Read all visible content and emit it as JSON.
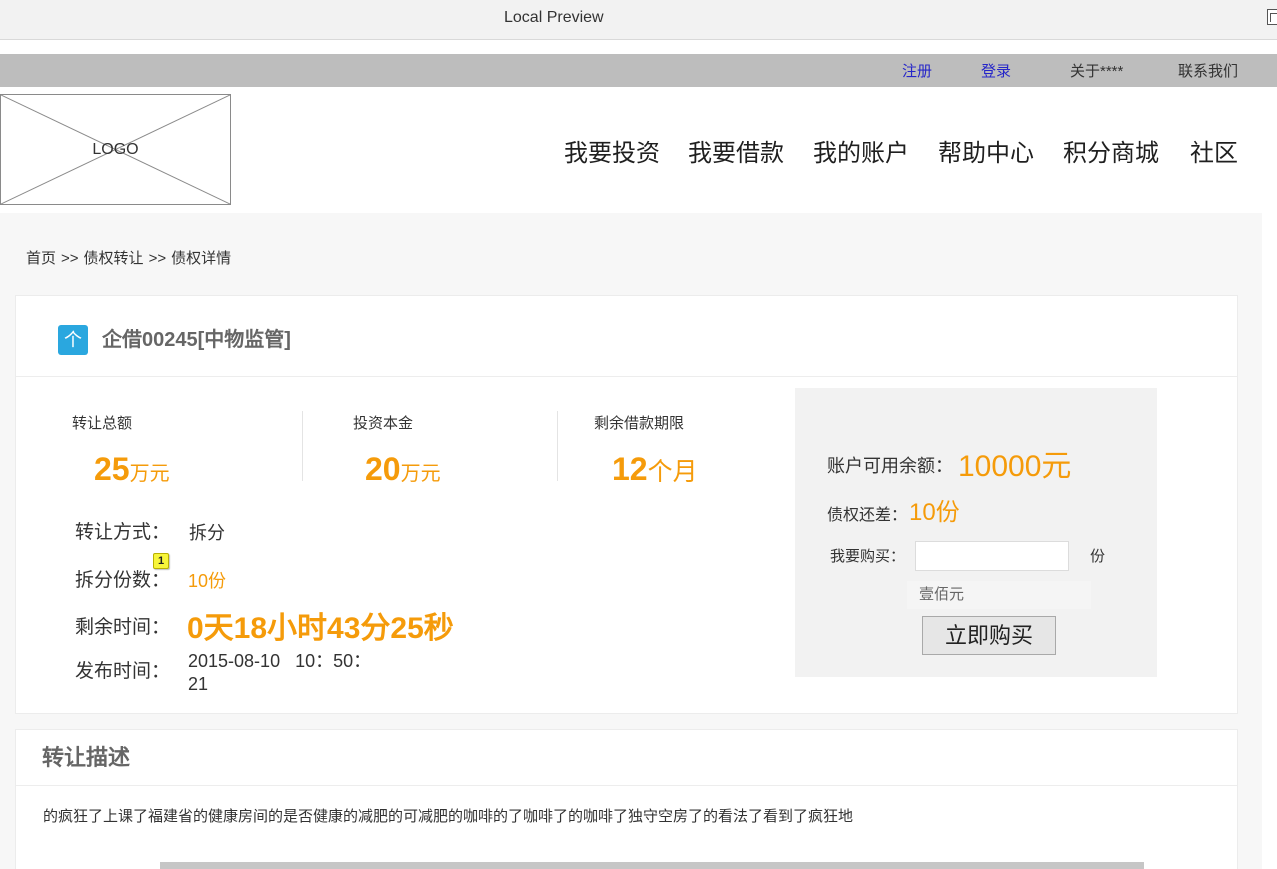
{
  "window": {
    "title": "Local Preview"
  },
  "colors": {
    "accent": "#f59b0a",
    "link": "#2626c9",
    "brand": "#2aa7df",
    "topbar": "#bdbdbd",
    "button": "#e6e6e6"
  },
  "icons": {
    "window": "window-icon",
    "logo": "logo-placeholder",
    "loan": "loan-badge-icon"
  },
  "topbar": {
    "links": [
      {
        "label": "注册"
      },
      {
        "label": "登录"
      },
      {
        "label": "关于****"
      },
      {
        "label": "联系我们"
      }
    ]
  },
  "header": {
    "logo_text": "LOGO",
    "nav": [
      {
        "label": "我要投资"
      },
      {
        "label": "我要借款"
      },
      {
        "label": "我的账户"
      },
      {
        "label": "帮助中心"
      },
      {
        "label": "积分商城"
      },
      {
        "label": "社区"
      }
    ]
  },
  "breadcrumb": {
    "items": [
      "首页",
      "债权转让",
      "债权详情"
    ],
    "separator": ">>"
  },
  "loan": {
    "icon_text": "个",
    "title": "企借00245[中物监管]",
    "stats": [
      {
        "label": "转让总额",
        "value": "25",
        "unit": "万元"
      },
      {
        "label": "投资本金",
        "value": "20",
        "unit": "万元"
      },
      {
        "label": "剩余借款期限",
        "value": "12",
        "unit": "个月"
      }
    ],
    "details": [
      {
        "label": "转让方式：",
        "value": "拆分"
      },
      {
        "label": "拆分份数：",
        "value": "10份"
      },
      {
        "label": "剩余时间：",
        "value": "0天18小时43分25秒"
      },
      {
        "label": "发布时间：",
        "value": "2015-08-10   10：50：21"
      }
    ],
    "annotation_marker": "1"
  },
  "purchase": {
    "balance_label": "账户可用余额：",
    "balance_value": "10000元",
    "remaining_label": "债权还差：",
    "remaining_value": "10份",
    "buy_label": "我要购买：",
    "buy_unit": "份",
    "amount_in_words": "壹佰元",
    "button_label": "立即购买"
  },
  "description": {
    "title": "转让描述",
    "text": "的疯狂了上课了福建省的健康房间的是否健康的减肥的可减肥的咖啡的了咖啡了的咖啡了独守空房了的看法了看到了疯狂地"
  }
}
